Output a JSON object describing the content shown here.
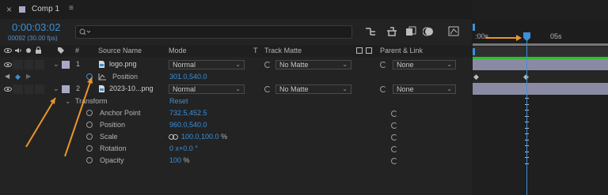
{
  "comp_tab": {
    "close": "×",
    "title": "Comp 1",
    "menu": "≡"
  },
  "timecode": {
    "value": "0:00:03:02",
    "frames": "00092 (30.00 fps)"
  },
  "search": {
    "placeholder": ""
  },
  "ruler": {
    "start": ":00s",
    "mark": "05s"
  },
  "headers": {
    "num": "#",
    "source": "Source Name",
    "mode": "Mode",
    "t": "T",
    "track_matte": "Track Matte",
    "parent": "Parent & Link"
  },
  "layers": [
    {
      "num": "1",
      "name": "logo.png",
      "mode": "Normal",
      "matte": "No Matte",
      "parent": "None",
      "color": "#a8a8c8"
    },
    {
      "num": "2",
      "name": "2023-10...png",
      "mode": "Normal",
      "matte": "No Matte",
      "parent": "None",
      "color": "#a8a8c8"
    }
  ],
  "position_prop": {
    "label": "Position",
    "value": "301.0,540.0"
  },
  "transform": {
    "label": "Transform",
    "reset": "Reset",
    "props": [
      {
        "label": "Anchor Point",
        "value": "732.5,452.5",
        "unit": ""
      },
      {
        "label": "Position",
        "value": "960.0,540.0",
        "unit": ""
      },
      {
        "label": "Scale",
        "value": "100.0,100.0",
        "unit": "%"
      },
      {
        "label": "Rotation",
        "value": "0 x+0.0 °",
        "unit": ""
      },
      {
        "label": "Opacity",
        "value": "100",
        "unit": "%"
      }
    ]
  },
  "colors": {
    "accent": "#3d8fd6",
    "annotation": "#e8952b",
    "keyframe_bar": "#2ebd2e"
  }
}
